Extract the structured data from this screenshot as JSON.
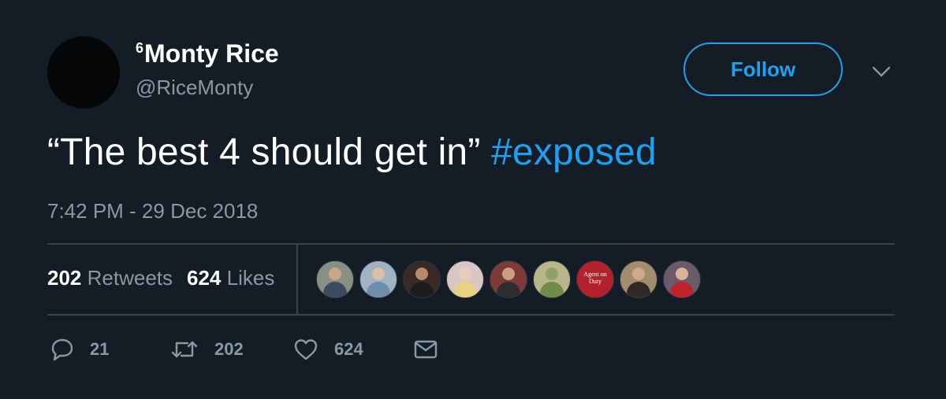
{
  "author": {
    "superscript": "6",
    "name": "Monty Rice",
    "handle": "@RiceMonty"
  },
  "follow_button": {
    "label": "Follow"
  },
  "tweet": {
    "text": "“The best 4 should get in” ",
    "hashtag": "#exposed",
    "timestamp": "7:42 PM - 29 Dec 2018"
  },
  "stats": {
    "retweets_count": "202",
    "retweets_label": "Retweets",
    "likes_count": "624",
    "likes_label": "Likes"
  },
  "liker_avatars": {
    "sign_text_line1": "Agent on",
    "sign_text_line2": "Duty"
  },
  "actions": {
    "reply_count": "21",
    "retweet_count": "202",
    "like_count": "624"
  },
  "icons": {
    "reply": "reply-icon",
    "retweet": "retweet-icon",
    "like": "heart-icon",
    "message": "envelope-icon",
    "more": "chevron-down-icon"
  },
  "colors": {
    "background": "#141d26",
    "accent": "#1da1f2",
    "secondary_text": "#8899a6",
    "divider": "#38444d"
  }
}
